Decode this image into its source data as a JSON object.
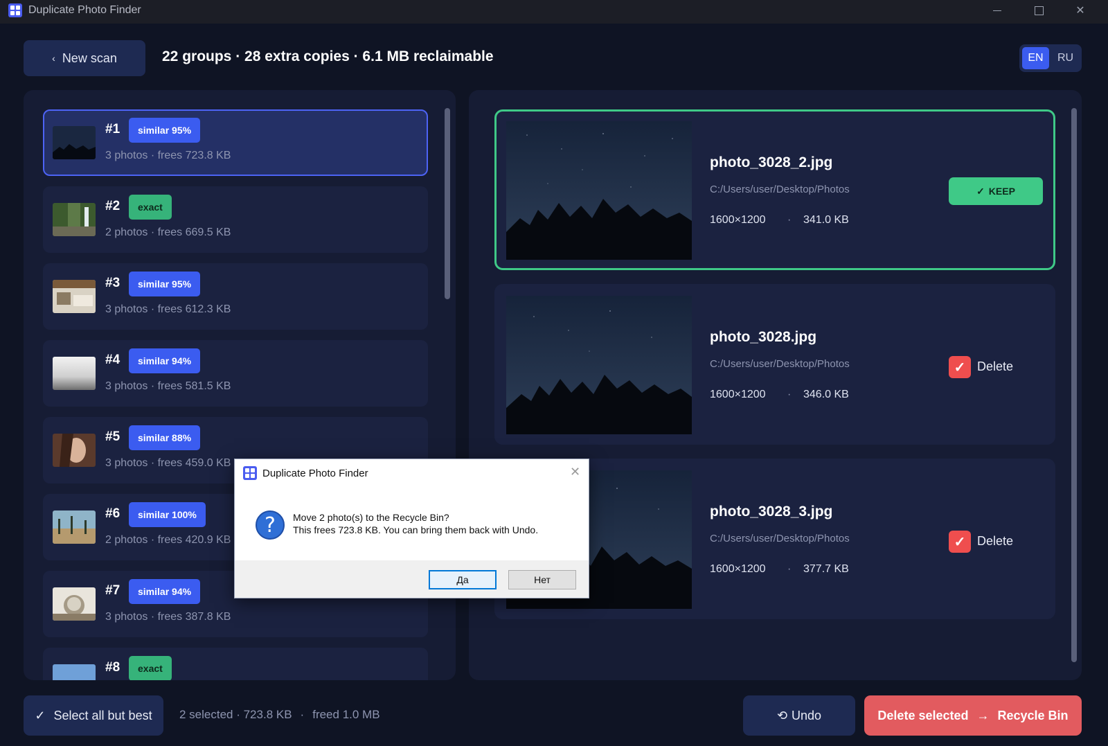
{
  "window": {
    "title": "Duplicate Photo Finder"
  },
  "header": {
    "new_scan": "New scan",
    "summary": "22 groups · 28 extra copies · 6.1 MB reclaimable",
    "lang": [
      "EN",
      "RU"
    ]
  },
  "groups": [
    {
      "num": "#1",
      "badge": "similar 95%",
      "meta": "3 photos · frees 723.8 KB"
    },
    {
      "num": "#2",
      "badge": "exact",
      "meta": "2 photos · frees 669.5 KB"
    },
    {
      "num": "#3",
      "badge": "similar 95%",
      "meta": "3 photos · frees 612.3 KB"
    },
    {
      "num": "#4",
      "badge": "similar 94%",
      "meta": "3 photos · frees 581.5 KB"
    },
    {
      "num": "#5",
      "badge": "similar 88%",
      "meta": "3 photos · frees 459.0 KB"
    },
    {
      "num": "#6",
      "badge": "similar 100%",
      "meta": "2 photos · frees 420.9 KB"
    },
    {
      "num": "#7",
      "badge": "similar 94%",
      "meta": "3 photos · frees 387.8 KB"
    },
    {
      "num": "#8",
      "badge": "exact",
      "meta": ""
    }
  ],
  "photos": [
    {
      "name": "photo_3028_2.jpg",
      "path": "C:/Users/user/Desktop/Photos",
      "dims": "1600×1200",
      "size": "341.0 KB",
      "action": "KEEP"
    },
    {
      "name": "photo_3028.jpg",
      "path": "C:/Users/user/Desktop/Photos",
      "dims": "1600×1200",
      "size": "346.0 KB",
      "action": "Delete"
    },
    {
      "name": "photo_3028_3.jpg",
      "path": "C:/Users/user/Desktop/Photos",
      "dims": "1600×1200",
      "size": "377.7 KB",
      "action": "Delete"
    }
  ],
  "bottom": {
    "select_all": "Select all but best",
    "selected": "2 selected · 723.8 KB",
    "sep": "·",
    "freed": "freed 1.0 MB",
    "undo": "Undo",
    "delete_left": "Delete selected",
    "delete_right": "Recycle Bin"
  },
  "dialog": {
    "title": "Duplicate Photo Finder",
    "line1": "Move 2 photo(s) to the Recycle Bin?",
    "line2": "This frees 723.8 KB. You can bring them back with Undo.",
    "yes": "Да",
    "no": "Нет"
  }
}
